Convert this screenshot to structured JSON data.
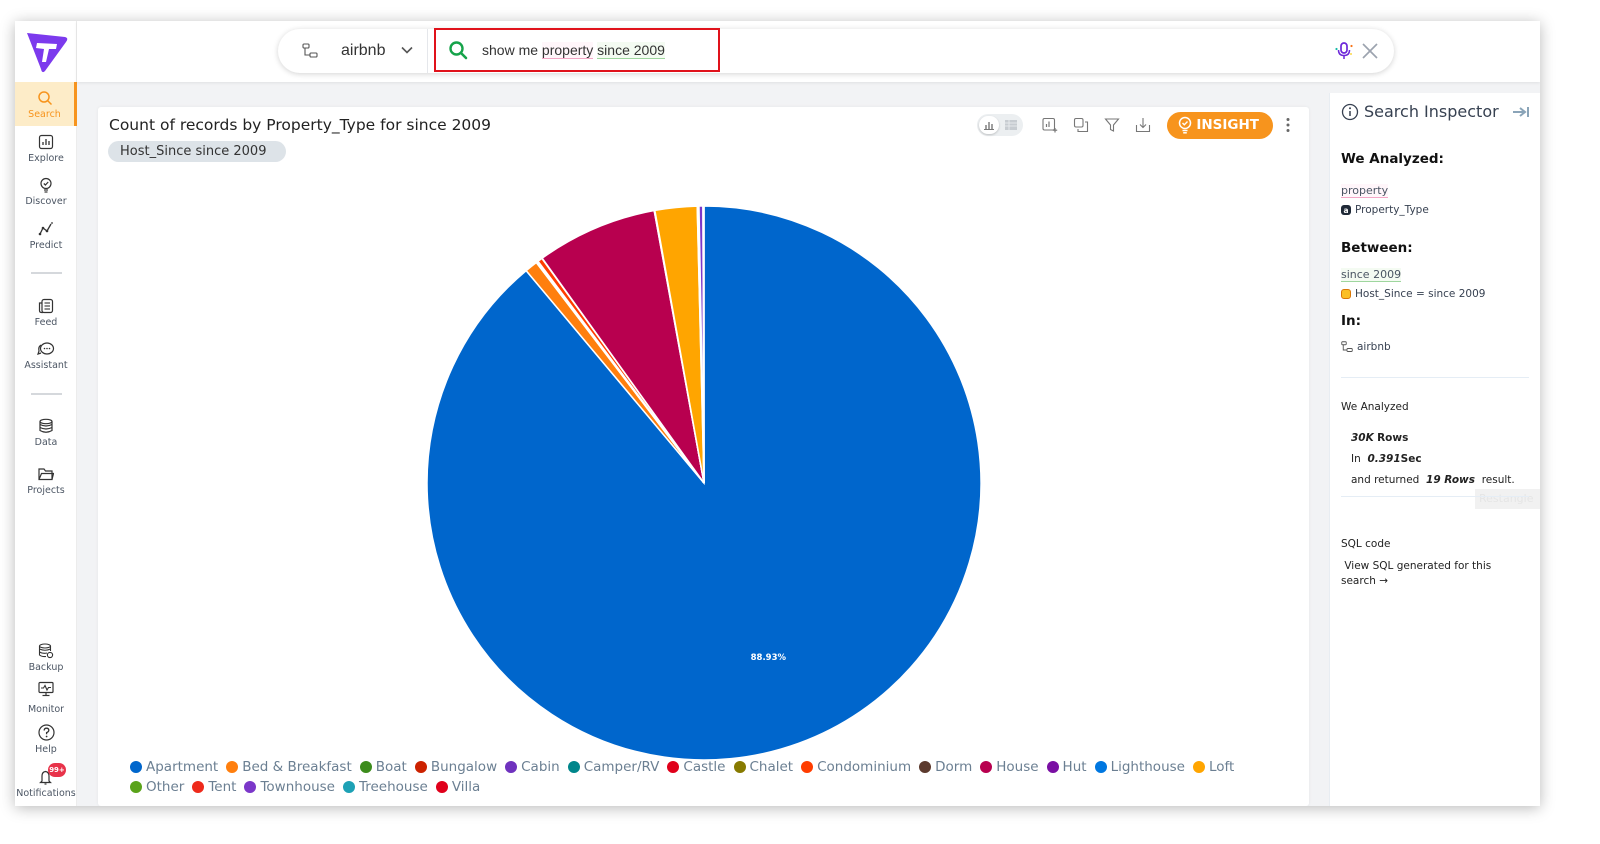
{
  "app": {
    "logo": "app-logo"
  },
  "sidebar": {
    "items": [
      {
        "label": "Search",
        "icon": "search-icon",
        "active": true
      },
      {
        "label": "Explore",
        "icon": "chart-icon"
      },
      {
        "label": "Discover",
        "icon": "bulb-icon"
      },
      {
        "label": "Predict",
        "icon": "predict-icon"
      },
      {
        "label": "Feed",
        "icon": "feed-icon"
      },
      {
        "label": "Assistant",
        "icon": "chat-icon"
      },
      {
        "label": "Data",
        "icon": "database-icon"
      },
      {
        "label": "Projects",
        "icon": "folder-icon"
      },
      {
        "label": "Backup",
        "icon": "backup-icon"
      },
      {
        "label": "Monitor",
        "icon": "monitor-icon"
      },
      {
        "label": "Help",
        "icon": "help-icon"
      },
      {
        "label": "Notifications",
        "icon": "bell-icon",
        "badge": "99+"
      }
    ]
  },
  "header": {
    "datasource": "airbnb",
    "query": {
      "prefix": "show me ",
      "token1": "property",
      "token2": "since 2009"
    }
  },
  "card": {
    "title": "Count of records by Property_Type for since 2009",
    "filter_chip": "Host_Since since 2009",
    "insight_label": "INSIGHT"
  },
  "inspector": {
    "title": "Search Inspector",
    "we_analyzed_heading": "We Analyzed:",
    "analyzed_token": "property",
    "analyzed_column": "Property_Type",
    "between_heading": "Between:",
    "between_token": "since 2009",
    "between_filter": "Host_Since = since 2009",
    "in_heading": "In:",
    "in_source": "airbnb",
    "stats_heading": "We Analyzed",
    "rows_value": "30K",
    "rows_label": "Rows",
    "time_prefix": "In",
    "time_value": "0.391",
    "time_unit": "Sec",
    "returned_prefix": "and returned",
    "returned_value": "19 Rows",
    "returned_suffix": "result.",
    "ghost_text": "Restangle",
    "sql_heading": "SQL code",
    "sql_link": "View SQL generated for this search →"
  },
  "chart_data": {
    "type": "pie",
    "title": "Count of records by Property_Type for since 2009",
    "start_angle_deg": 0,
    "direction": "clockwise",
    "label_shown": "88.93%",
    "legend_position": "bottom",
    "categories": [
      "Apartment",
      "Bed & Breakfast",
      "Boat",
      "Bungalow",
      "Cabin",
      "Camper/RV",
      "Castle",
      "Chalet",
      "Condominium",
      "Dorm",
      "House",
      "Hut",
      "Lighthouse",
      "Loft",
      "Other",
      "Tent",
      "Townhouse",
      "Treehouse",
      "Villa"
    ],
    "values_percent": [
      88.93,
      0.75,
      0.02,
      0.02,
      0.02,
      0.02,
      0.02,
      0.02,
      0.28,
      0.02,
      7.05,
      0.02,
      0.02,
      2.45,
      0.08,
      0.02,
      0.23,
      0.02,
      0.04
    ],
    "colors": [
      "#0066cc",
      "#ff7f0e",
      "#3c8c1c",
      "#cc2200",
      "#6f32be",
      "#00868b",
      "#e0001b",
      "#877a00",
      "#ff3d00",
      "#5c3a2e",
      "#b8004f",
      "#7a0fa3",
      "#0077e0",
      "#ffa500",
      "#5aa31a",
      "#ee2a1b",
      "#7b37c9",
      "#1da1b5",
      "#e0001b"
    ]
  }
}
